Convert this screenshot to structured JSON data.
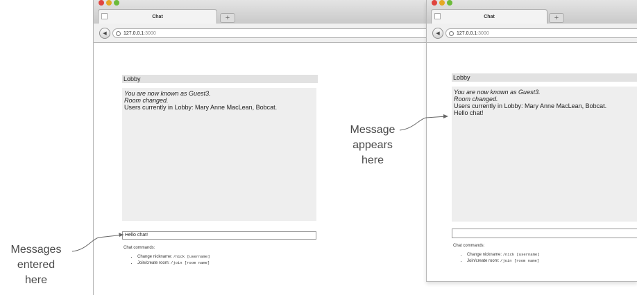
{
  "left_window": {
    "tab_title": "Chat",
    "new_tab": "+",
    "url_host": "127.0.0.1",
    "url_port": ":3000",
    "room_name": "Lobby",
    "messages": [
      "You are now known as Guest3.",
      "Room changed.",
      "Users currently in Lobby: Mary Anne MacLean, Bobcat."
    ],
    "input_value": "Hello chat!",
    "commands_heading": "Chat commands:",
    "command_nick_label": "Change nickname:",
    "command_nick_syntax": "/nick [username]",
    "command_join_label": "Join/create room:",
    "command_join_syntax": "/join [room name]"
  },
  "right_window": {
    "tab_title": "Chat",
    "new_tab": "+",
    "url_host": "127.0.0.1",
    "url_port": ":3000",
    "room_name": "Lobby",
    "messages": [
      "You are now known as Guest3.",
      "Room changed.",
      "Users currently in Lobby: Mary Anne MacLean, Bobcat.",
      "Hello chat!"
    ],
    "input_value": "",
    "commands_heading": "Chat commands:",
    "command_nick_label": "Change nickname:",
    "command_nick_syntax": "/nick [username]",
    "command_join_label": "Join/create room:",
    "command_join_syntax": "/join [room name]"
  },
  "annotations": {
    "left_line1": "Messages",
    "left_line2": "entered",
    "left_line3": "here",
    "right_line1": "Message",
    "right_line2": "appears",
    "right_line3": "here"
  },
  "colors": {
    "message_area": "#eeeeee",
    "room_bar": "#e2e2e2",
    "callout_text": "#4a4a4a"
  }
}
